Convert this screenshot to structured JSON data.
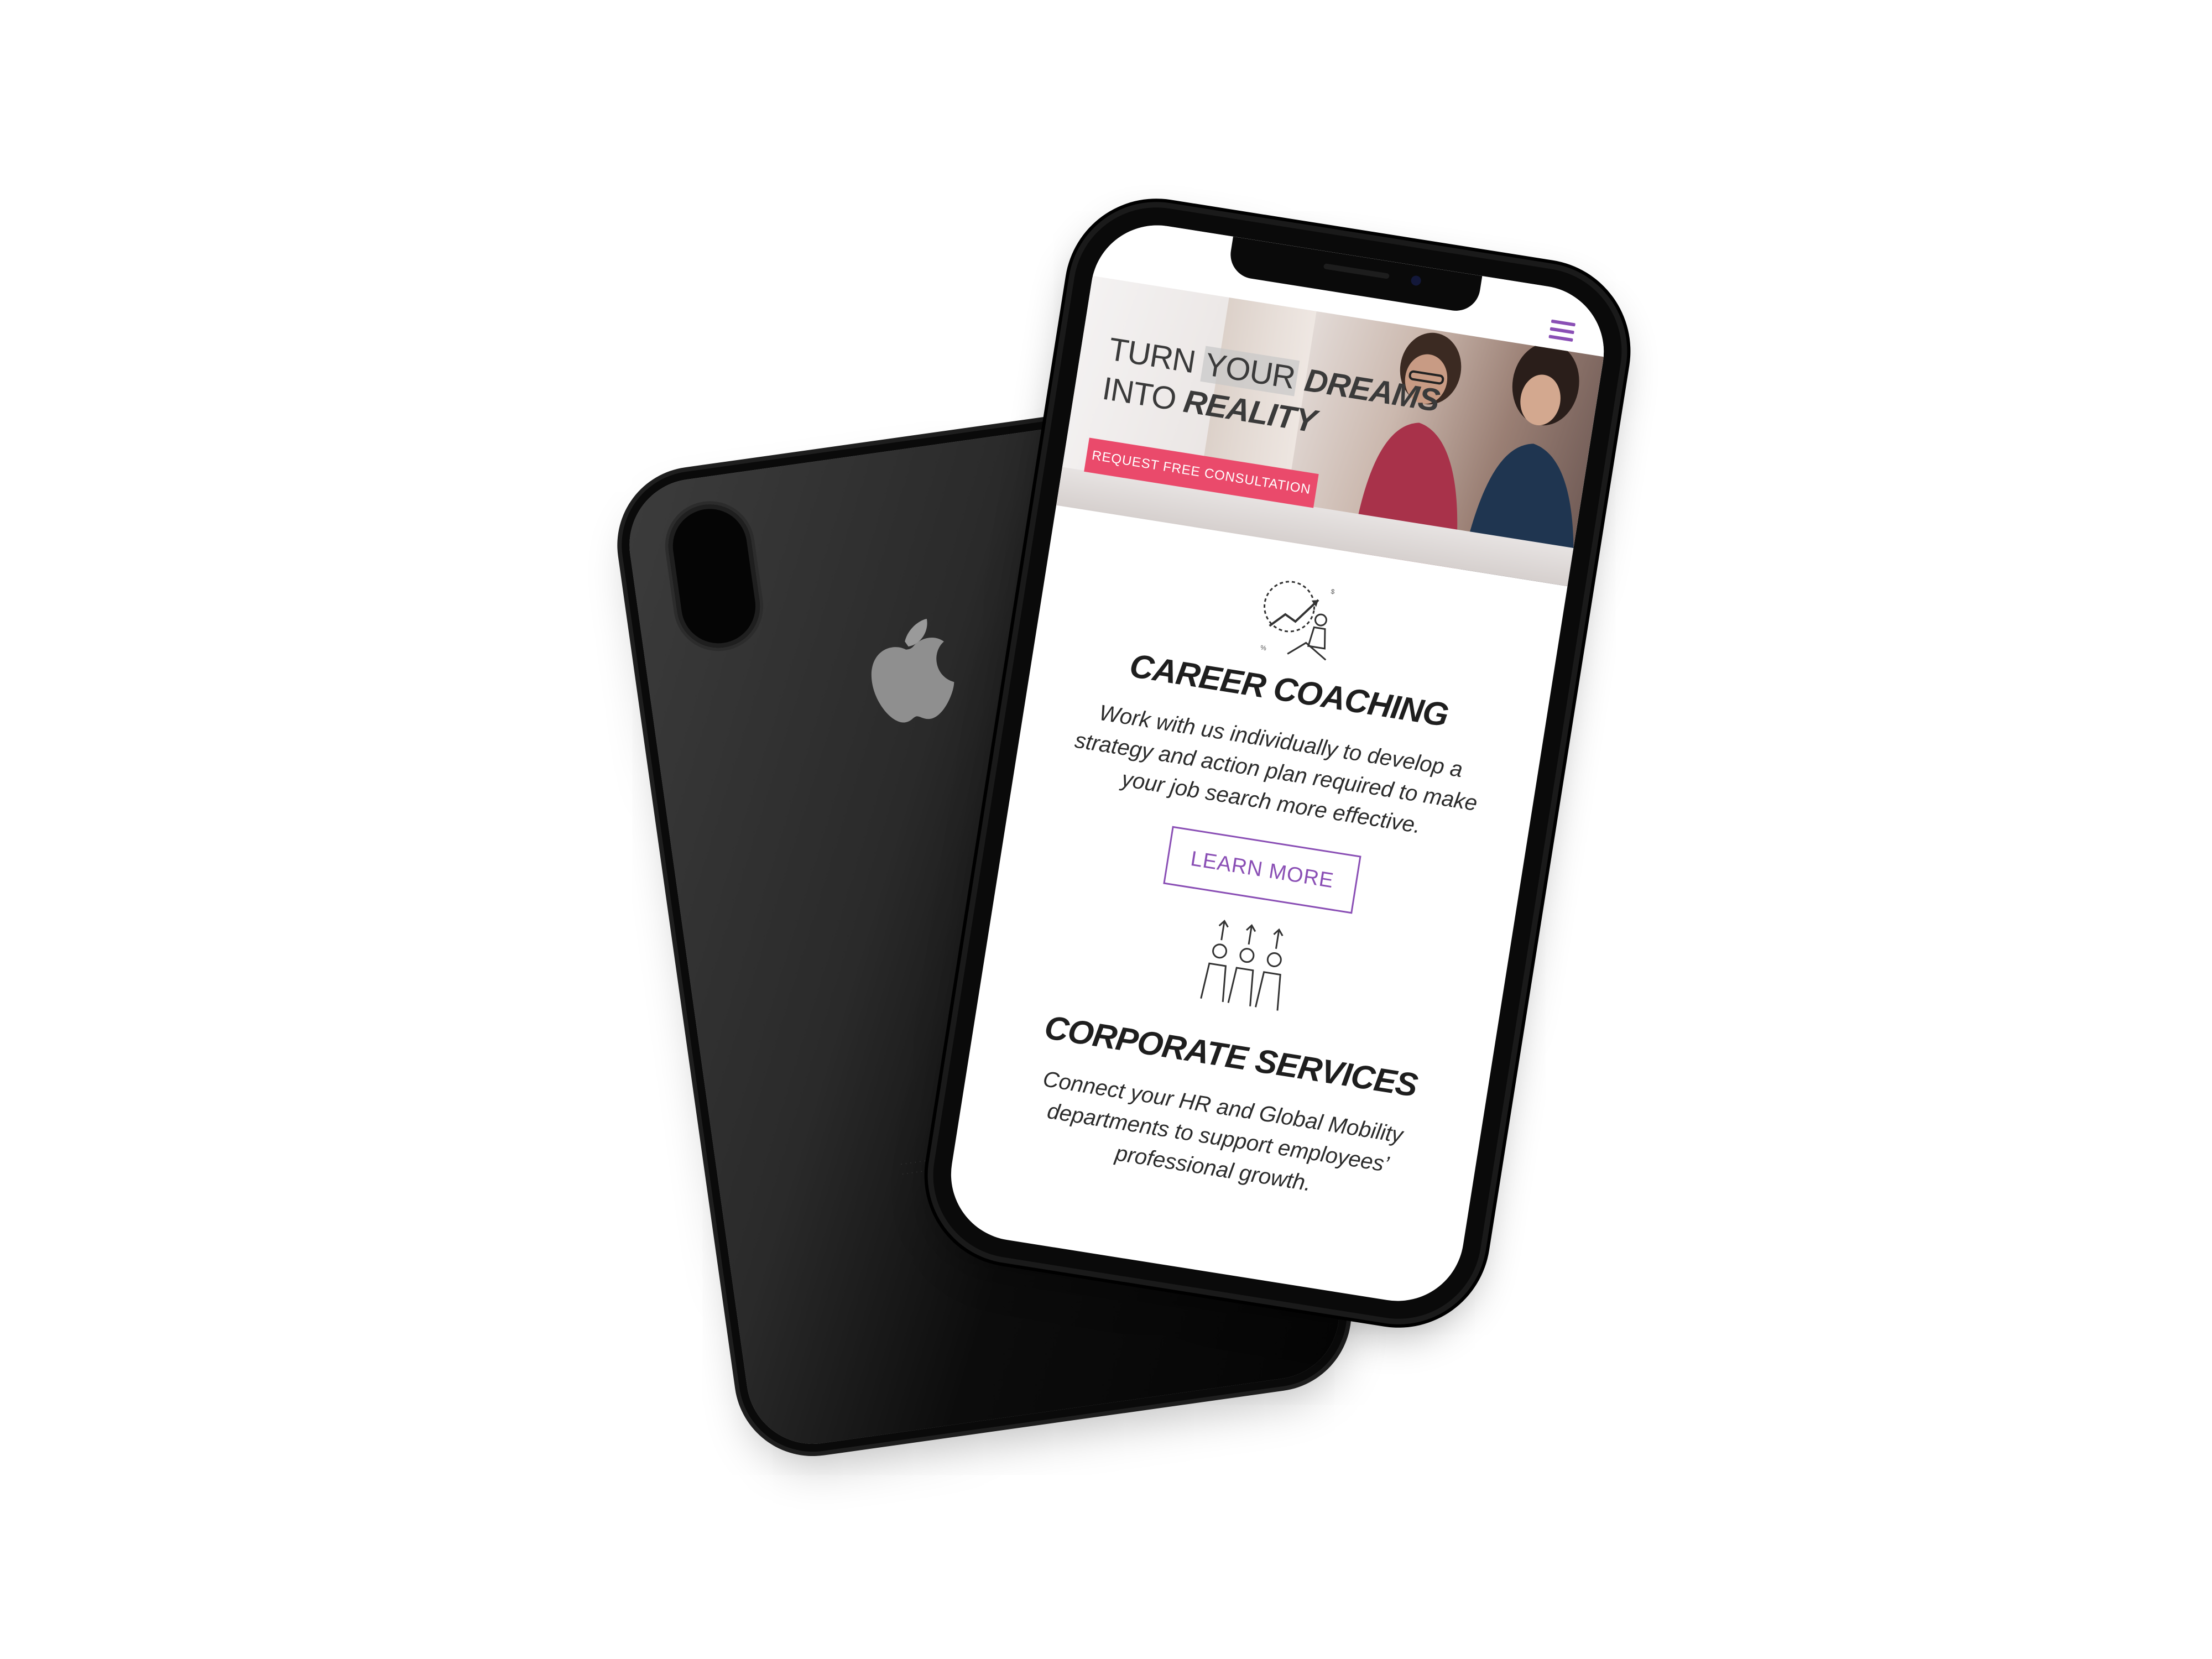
{
  "hero": {
    "title_line1_light": "TURN ",
    "title_line1_highlight": "YOUR",
    "title_line1_bold": " DREAMS",
    "title_line2_light": "INTO ",
    "title_line2_bold": "REALITY",
    "cta_label": "REQUEST FREE CONSULTATION"
  },
  "services": [
    {
      "icon": "career-growth-icon",
      "title": "CAREER COACHING",
      "text": "Work with us individually to develop a strategy and action plan required to make your job search more effective.",
      "button_label": "LEARN MORE"
    },
    {
      "icon": "team-growth-icon",
      "title": "CORPORATE SERVICES",
      "text": "Connect your HR and Global Mobility departments to support employees’ professional growth."
    }
  ],
  "nav": {
    "menu_icon": "hamburger-menu-icon"
  },
  "colors": {
    "accent_purple": "#8a4fb5",
    "cta_pink": "#ea4a6b",
    "text_dark": "#1e1e1e"
  }
}
